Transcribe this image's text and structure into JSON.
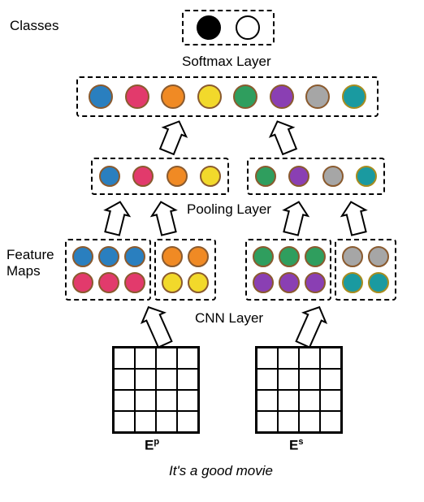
{
  "labels": {
    "classes": "Classes",
    "softmax": "Softmax Layer",
    "pooling": "Pooling Layer",
    "featureMaps": "Feature\nMaps",
    "cnn": "CNN Layer",
    "inputLeft": "E",
    "inputLeftSup": "p",
    "inputRight": "E",
    "inputRightSup": "s",
    "caption": "It's a good movie"
  },
  "colors": {
    "classBlack": "#000000",
    "classWhite": "#ffffff",
    "blue": "#2a7fbf",
    "pink": "#e23a6c",
    "orange": "#f08a24",
    "yellow": "#f2d92b",
    "green": "#2f9e5e",
    "purple": "#8a3fb3",
    "gray": "#a6a6a6",
    "teal": "#1a9aa0",
    "brownStroke": "#8a5a2e",
    "oliveStroke": "#a88c1f",
    "black": "#000000",
    "white": "#ffffff"
  },
  "structure": {
    "classes": [
      {
        "fill": "classBlack",
        "stroke": "black"
      },
      {
        "fill": "classWhite",
        "stroke": "black"
      }
    ],
    "softmax": [
      {
        "fill": "blue",
        "stroke": "brownStroke"
      },
      {
        "fill": "pink",
        "stroke": "brownStroke"
      },
      {
        "fill": "orange",
        "stroke": "brownStroke"
      },
      {
        "fill": "yellow",
        "stroke": "brownStroke"
      },
      {
        "fill": "green",
        "stroke": "brownStroke"
      },
      {
        "fill": "purple",
        "stroke": "brownStroke"
      },
      {
        "fill": "gray",
        "stroke": "brownStroke"
      },
      {
        "fill": "teal",
        "stroke": "oliveStroke"
      }
    ],
    "poolingGroups": [
      [
        {
          "fill": "blue",
          "stroke": "brownStroke"
        },
        {
          "fill": "pink",
          "stroke": "brownStroke"
        },
        {
          "fill": "orange",
          "stroke": "brownStroke"
        },
        {
          "fill": "yellow",
          "stroke": "brownStroke"
        }
      ],
      [
        {
          "fill": "green",
          "stroke": "brownStroke"
        },
        {
          "fill": "purple",
          "stroke": "brownStroke"
        },
        {
          "fill": "gray",
          "stroke": "brownStroke"
        },
        {
          "fill": "teal",
          "stroke": "oliveStroke"
        }
      ]
    ],
    "featureMaps": [
      {
        "cols": 3,
        "cells": [
          {
            "fill": "blue",
            "stroke": "brownStroke"
          },
          {
            "fill": "blue",
            "stroke": "brownStroke"
          },
          {
            "fill": "blue",
            "stroke": "brownStroke"
          },
          {
            "fill": "pink",
            "stroke": "brownStroke"
          },
          {
            "fill": "pink",
            "stroke": "brownStroke"
          },
          {
            "fill": "pink",
            "stroke": "brownStroke"
          }
        ]
      },
      {
        "cols": 2,
        "cells": [
          {
            "fill": "orange",
            "stroke": "brownStroke"
          },
          {
            "fill": "orange",
            "stroke": "brownStroke"
          },
          {
            "fill": "yellow",
            "stroke": "brownStroke"
          },
          {
            "fill": "yellow",
            "stroke": "brownStroke"
          }
        ]
      },
      {
        "cols": 3,
        "cells": [
          {
            "fill": "green",
            "stroke": "brownStroke"
          },
          {
            "fill": "green",
            "stroke": "brownStroke"
          },
          {
            "fill": "green",
            "stroke": "brownStroke"
          },
          {
            "fill": "purple",
            "stroke": "brownStroke"
          },
          {
            "fill": "purple",
            "stroke": "brownStroke"
          },
          {
            "fill": "purple",
            "stroke": "brownStroke"
          }
        ]
      },
      {
        "cols": 2,
        "cells": [
          {
            "fill": "gray",
            "stroke": "brownStroke"
          },
          {
            "fill": "gray",
            "stroke": "brownStroke"
          },
          {
            "fill": "teal",
            "stroke": "oliveStroke"
          },
          {
            "fill": "teal",
            "stroke": "oliveStroke"
          }
        ]
      }
    ]
  }
}
